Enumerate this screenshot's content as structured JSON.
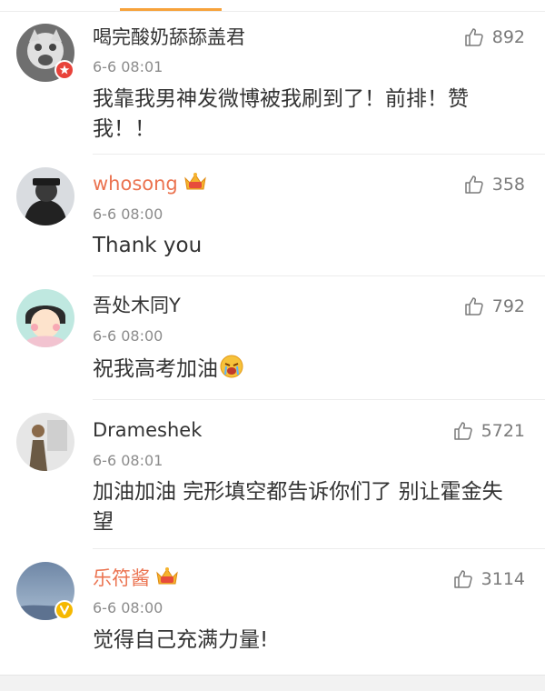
{
  "comments": [
    {
      "username": "喝完酸奶舔舔盖君",
      "time": "6-6 08:01",
      "text": "我靠我男神发微博被我刷到了！前排！赞我！！",
      "likes": "892",
      "vip": false,
      "badge": "red-star-badge"
    },
    {
      "username": "whosong",
      "time": "6-6 08:00",
      "text": "Thank you",
      "likes": "358",
      "vip": true
    },
    {
      "username": "吾处木同Y",
      "time": "6-6 08:00",
      "text": "祝我高考加油",
      "likes": "792",
      "vip": false,
      "emoji": "crying-emoji"
    },
    {
      "username": "Drameshek",
      "time": "6-6 08:01",
      "text": "加油加油 完形填空都告诉你们了 别让霍金失望",
      "likes": "5721",
      "vip": false
    },
    {
      "username": "乐符酱",
      "time": "6-6 08:00",
      "text": "觉得自己充满力量!",
      "likes": "3114",
      "vip": true,
      "badge": "yellow-verified-badge"
    }
  ],
  "colors": {
    "vip_name": "#eb7350",
    "tab_accent": "#f7a23b",
    "meta_text": "#8c8c8c"
  }
}
